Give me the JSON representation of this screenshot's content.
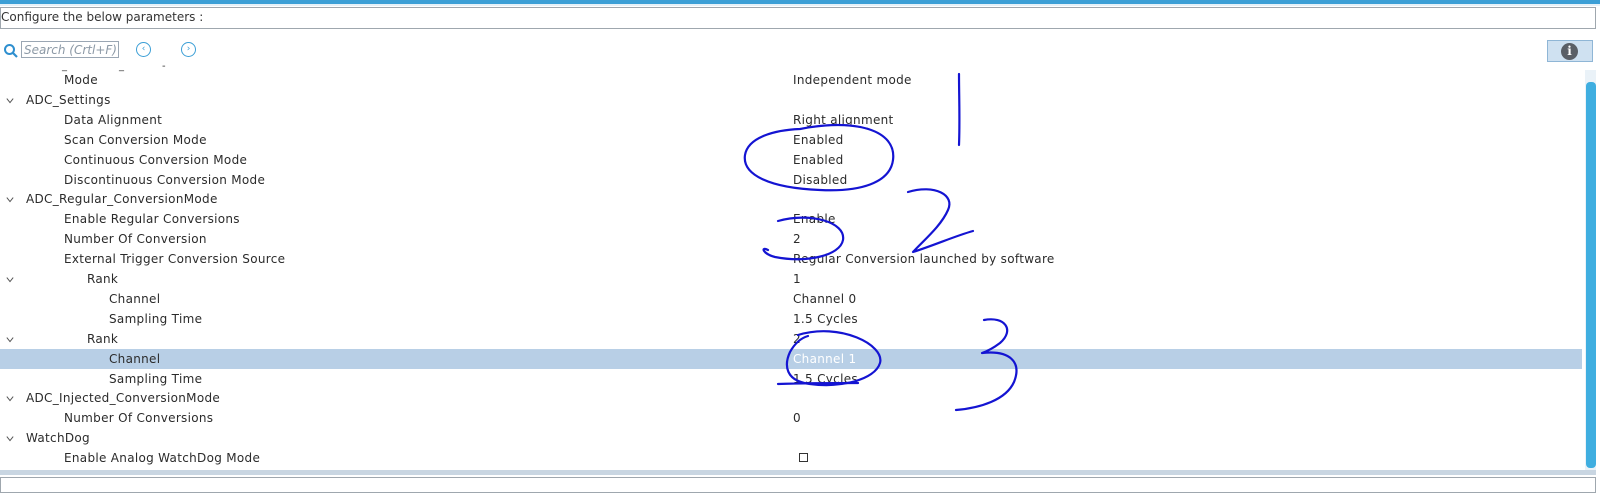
{
  "header": {
    "configure_label": "Configure the below parameters :"
  },
  "toolbar": {
    "search_placeholder": "Search (Crtl+F)",
    "prev_icon": "chevron-left-circle-icon",
    "next_icon": "chevron-right-circle-icon",
    "info_icon": "info-icon"
  },
  "tree": {
    "rows": [
      {
        "label": "Mode",
        "value": "Independent mode"
      },
      {
        "label": "ADC_Settings",
        "value": ""
      },
      {
        "label": "Data Alignment",
        "value": "Right alignment"
      },
      {
        "label": "Scan Conversion Mode",
        "value": "Enabled"
      },
      {
        "label": "Continuous Conversion Mode",
        "value": "Enabled"
      },
      {
        "label": "Discontinuous Conversion Mode",
        "value": "Disabled"
      },
      {
        "label": "ADC_Regular_ConversionMode",
        "value": ""
      },
      {
        "label": "Enable Regular Conversions",
        "value": "Enable"
      },
      {
        "label": "Number Of Conversion",
        "value": "2"
      },
      {
        "label": "External Trigger Conversion Source",
        "value": "Regular Conversion launched by software"
      },
      {
        "label": "Rank",
        "value": "1"
      },
      {
        "label": "Channel",
        "value": "Channel 0"
      },
      {
        "label": "Sampling Time",
        "value": "1.5 Cycles"
      },
      {
        "label": "Rank",
        "value": "2"
      },
      {
        "label": "Channel",
        "value": "Channel 1"
      },
      {
        "label": "Sampling Time",
        "value": "1.5 Cycles"
      },
      {
        "label": "ADC_Injected_ConversionMode",
        "value": ""
      },
      {
        "label": "Number Of Conversions",
        "value": "0"
      },
      {
        "label": "WatchDog",
        "value": ""
      },
      {
        "label": "Enable Analog WatchDog Mode",
        "value": ""
      }
    ],
    "selected_row": 14
  },
  "annotations": {
    "numbers": [
      "1",
      "2",
      "3"
    ],
    "ink_color": "#1414d2"
  },
  "colors": {
    "accent": "#3c9fd6",
    "selection": "#b8cfe6"
  }
}
